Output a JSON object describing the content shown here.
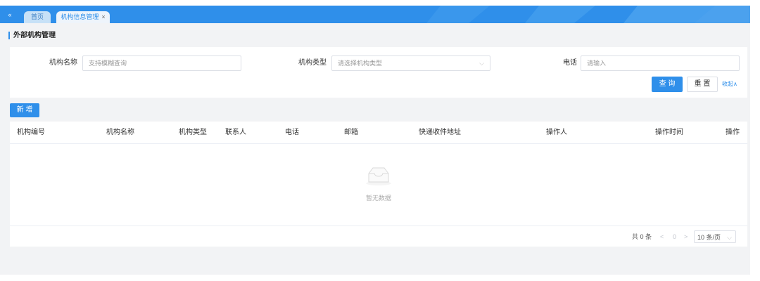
{
  "tabs": {
    "collapse_icon": "«",
    "items": [
      {
        "label": "首页",
        "active": false
      },
      {
        "label": "机构信息管理",
        "active": true,
        "close": "×"
      }
    ]
  },
  "page": {
    "title": "外部机构管理"
  },
  "search": {
    "name_label": "机构名称",
    "name_placeholder": "支持模糊查询",
    "type_label": "机构类型",
    "type_placeholder": "请选择机构类型",
    "phone_label": "电话",
    "phone_placeholder": "请输入",
    "query_button": "查 询",
    "reset_button": "重 置",
    "collapse_link": "收起∧"
  },
  "toolbar": {
    "add_button": "新 增"
  },
  "table": {
    "columns": [
      "机构编号",
      "机构名称",
      "机构类型",
      "联系人",
      "电话",
      "邮箱",
      "快递收件地址",
      "操作人",
      "操作时间",
      "操作"
    ],
    "empty_text": "暂无数据"
  },
  "pagination": {
    "total": "共 0 条",
    "prev": "<",
    "page": "0",
    "next": ">",
    "page_size": "10 条/页"
  },
  "colors": {
    "primary": "#2f8fea",
    "background": "#f2f3f5"
  }
}
